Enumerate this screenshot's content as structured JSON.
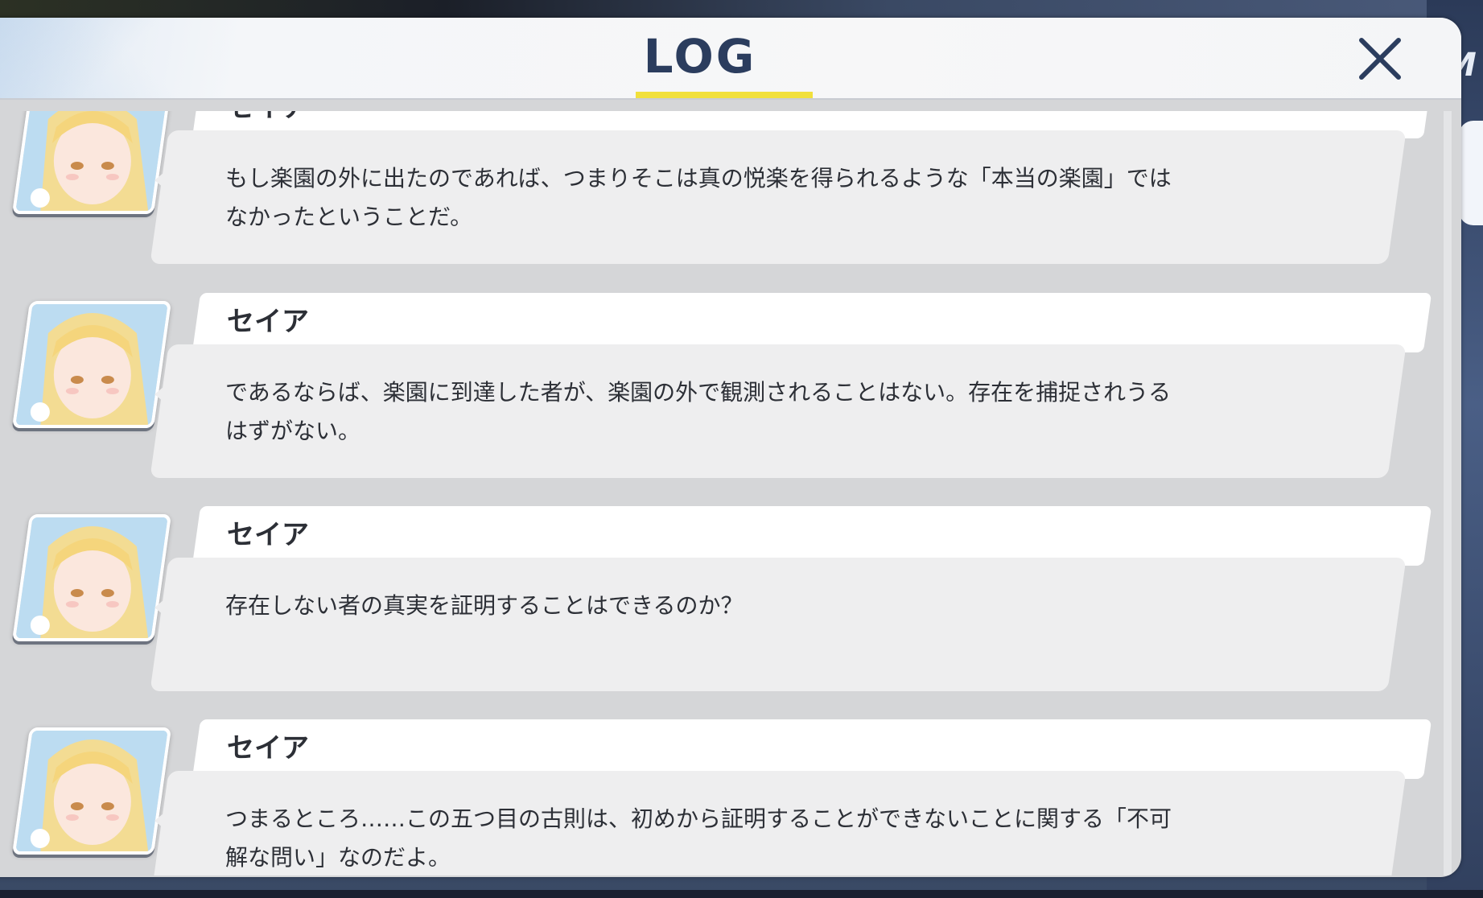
{
  "window": {
    "title": "LOG"
  },
  "background": {
    "right_glyph": "M"
  },
  "colors": {
    "title": "#2b3d5e",
    "underline": "#f1e03c",
    "panel": "#d5d6d8",
    "bubble": "#eeeeef",
    "name_tab": "#ffffff",
    "text": "#2c2f36"
  },
  "icons": {
    "close": "close-x-icon",
    "avatar": "character-portrait"
  },
  "entries": [
    {
      "name": "セイア",
      "text": "もし楽園の外に出たのであれば、つまりそこは真の悦楽を得られるような「本当の楽園」では\nなかったということだ。"
    },
    {
      "name": "セイア",
      "text": "であるならば、楽園に到達した者が、楽園の外で観測されることはない。存在を捕捉されうる\nはずがない。"
    },
    {
      "name": "セイア",
      "text": "存在しない者の真実を証明することはできるのか？"
    },
    {
      "name": "セイア",
      "text": "つまるところ……この五つ目の古則は、初めから証明することができないことに関する「不可\n解な問い」なのだよ。"
    }
  ]
}
